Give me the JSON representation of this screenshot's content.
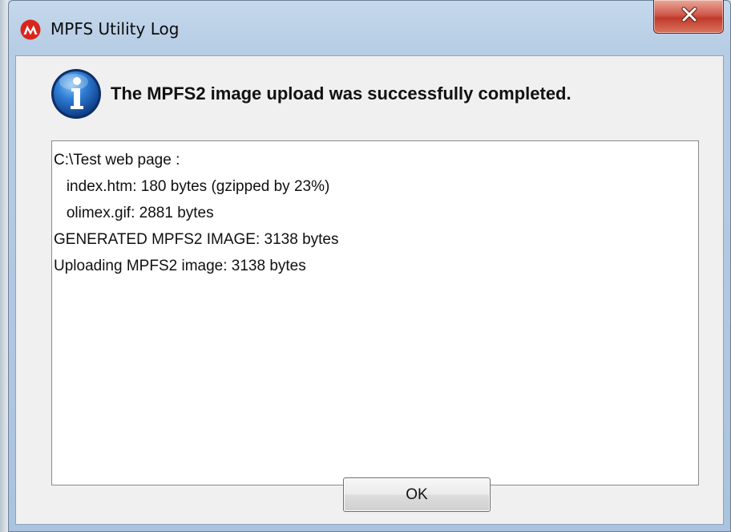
{
  "window": {
    "title": "MPFS Utility Log"
  },
  "dialog": {
    "message": "The MPFS2 image upload was successfully completed.",
    "icon": "info-icon",
    "log_lines": [
      "C:\\Test web page :",
      "   index.htm: 180 bytes (gzipped by 23%)",
      "   olimex.gif: 2881 bytes",
      "GENERATED MPFS2 IMAGE: 3138 bytes",
      "Uploading MPFS2 image: 3138 bytes"
    ],
    "ok_label": "OK"
  },
  "icons": {
    "app": "microchip-logo-icon",
    "close": "close-icon",
    "info": "info-icon"
  },
  "colors": {
    "close_button": "#c0392b",
    "app_logo": "#d9261c",
    "info_icon": "#1f63b8"
  }
}
